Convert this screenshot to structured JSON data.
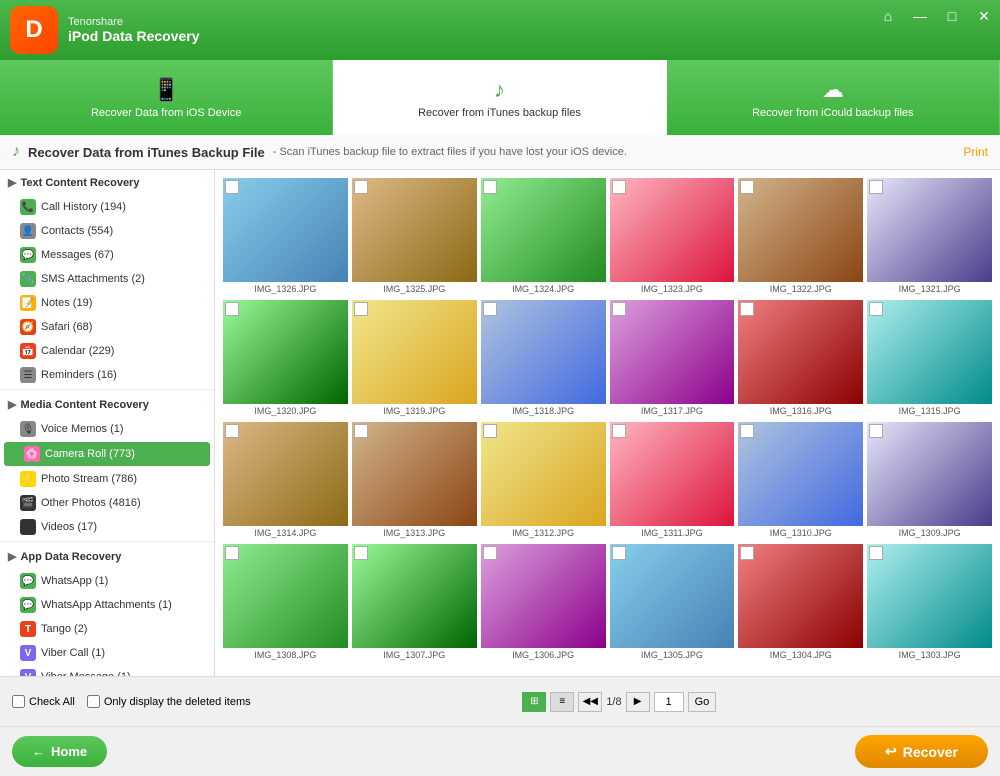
{
  "app": {
    "brand": "Tenorshare",
    "product": "iPod Data Recovery",
    "logo": "D"
  },
  "title_bar_controls": {
    "home_icon": "⌂",
    "minimize_icon": "—",
    "maximize_icon": "□",
    "close_icon": "✕"
  },
  "tabs": [
    {
      "id": "ios",
      "label": "Recover Data from iOS Device",
      "icon": "📱",
      "active": false
    },
    {
      "id": "itunes",
      "label": "Recover from iTunes backup files",
      "icon": "♪",
      "active": true
    },
    {
      "id": "icloud",
      "label": "Recover from iCould backup files",
      "icon": "☁",
      "active": false
    }
  ],
  "header": {
    "icon": "♪",
    "title": "Recover Data from iTunes Backup File",
    "desc": "- Scan iTunes backup file to extract files if you have lost your iOS device.",
    "print": "Print"
  },
  "sidebar": {
    "sections": [
      {
        "id": "text-content",
        "label": "Text Content Recovery",
        "items": [
          {
            "id": "call-history",
            "label": "Call History (194)",
            "icon": "📞",
            "iconColor": "#4CAF50"
          },
          {
            "id": "contacts",
            "label": "Contacts (554)",
            "icon": "👤",
            "iconColor": "#888"
          },
          {
            "id": "messages",
            "label": "Messages (67)",
            "icon": "💬",
            "iconColor": "#4CAF50"
          },
          {
            "id": "sms-attachments",
            "label": "SMS Attachments (2)",
            "icon": "📎",
            "iconColor": "#4CAF50"
          },
          {
            "id": "notes",
            "label": "Notes (19)",
            "icon": "📝",
            "iconColor": "#FFB300"
          },
          {
            "id": "safari",
            "label": "Safari (68)",
            "icon": "🧭",
            "iconColor": "#e84118"
          },
          {
            "id": "calendar",
            "label": "Calendar (229)",
            "icon": "📅",
            "iconColor": "#e84118"
          },
          {
            "id": "reminders",
            "label": "Reminders (16)",
            "icon": "☰",
            "iconColor": "#888"
          }
        ]
      },
      {
        "id": "media-content",
        "label": "Media Content Recovery",
        "items": [
          {
            "id": "voice-memos",
            "label": "Voice Memos (1)",
            "icon": "🎙",
            "iconColor": "#888"
          },
          {
            "id": "camera-roll",
            "label": "Camera Roll (773)",
            "icon": "🌸",
            "iconColor": "#FF69B4",
            "active": true
          },
          {
            "id": "photo-stream",
            "label": "Photo Stream (786)",
            "icon": "🌟",
            "iconColor": "#FFD700"
          },
          {
            "id": "other-photos",
            "label": "Other Photos (4816)",
            "icon": "🎬",
            "iconColor": "#333"
          },
          {
            "id": "videos",
            "label": "Videos (17)",
            "icon": "▶",
            "iconColor": "#333"
          }
        ]
      },
      {
        "id": "app-data",
        "label": "App Data Recovery",
        "items": [
          {
            "id": "whatsapp",
            "label": "WhatsApp (1)",
            "icon": "💬",
            "iconColor": "#4CAF50"
          },
          {
            "id": "whatsapp-attachments",
            "label": "WhatsApp Attachments (1)",
            "icon": "💬",
            "iconColor": "#4CAF50"
          },
          {
            "id": "tango",
            "label": "Tango (2)",
            "icon": "T",
            "iconColor": "#e84118"
          },
          {
            "id": "viber-call",
            "label": "Viber Call (1)",
            "icon": "V",
            "iconColor": "#7B68EE"
          },
          {
            "id": "viber-message",
            "label": "Viber Message (1)",
            "icon": "V",
            "iconColor": "#7B68EE"
          }
        ]
      }
    ]
  },
  "photos": [
    {
      "id": "p1",
      "name": "IMG_1326.JPG",
      "colorClass": "p1"
    },
    {
      "id": "p2",
      "name": "IMG_1325.JPG",
      "colorClass": "p2"
    },
    {
      "id": "p3",
      "name": "IMG_1324.JPG",
      "colorClass": "p3"
    },
    {
      "id": "p4",
      "name": "IMG_1323.JPG",
      "colorClass": "p4"
    },
    {
      "id": "p5",
      "name": "IMG_1322.JPG",
      "colorClass": "p5"
    },
    {
      "id": "p6",
      "name": "IMG_1321.JPG",
      "colorClass": "p6"
    },
    {
      "id": "p7",
      "name": "IMG_1320.JPG",
      "colorClass": "p7"
    },
    {
      "id": "p8",
      "name": "IMG_1319.JPG",
      "colorClass": "p8"
    },
    {
      "id": "p9",
      "name": "IMG_1318.JPG",
      "colorClass": "p9"
    },
    {
      "id": "p10",
      "name": "IMG_1317.JPG",
      "colorClass": "p10"
    },
    {
      "id": "p11",
      "name": "IMG_1316.JPG",
      "colorClass": "p11"
    },
    {
      "id": "p12",
      "name": "IMG_1315.JPG",
      "colorClass": "p12"
    },
    {
      "id": "p1",
      "name": "IMG_1314.JPG",
      "colorClass": "p2"
    },
    {
      "id": "p2",
      "name": "IMG_1313.JPG",
      "colorClass": "p5"
    },
    {
      "id": "p3",
      "name": "IMG_1312.JPG",
      "colorClass": "p8"
    },
    {
      "id": "p4",
      "name": "IMG_1311.JPG",
      "colorClass": "p4"
    },
    {
      "id": "p5",
      "name": "IMG_1310.JPG",
      "colorClass": "p9"
    },
    {
      "id": "p6",
      "name": "IMG_1309.JPG",
      "colorClass": "p6"
    },
    {
      "id": "p7",
      "name": "IMG_1308.JPG",
      "colorClass": "p3"
    },
    {
      "id": "p8",
      "name": "IMG_1307.JPG",
      "colorClass": "p7"
    },
    {
      "id": "p9",
      "name": "IMG_1306.JPG",
      "colorClass": "p10"
    },
    {
      "id": "p10",
      "name": "IMG_1305.JPG",
      "colorClass": "p1"
    },
    {
      "id": "p11",
      "name": "IMG_1304.JPG",
      "colorClass": "p11"
    },
    {
      "id": "p12",
      "name": "IMG_1303.JPG",
      "colorClass": "p12"
    }
  ],
  "bottom_toolbar": {
    "check_all": "Check All",
    "only_deleted": "Only display the deleted items",
    "page_info": "1/8",
    "page_num": "1",
    "go_label": "Go"
  },
  "footer": {
    "home_label": "Home",
    "recover_label": "Recover"
  }
}
